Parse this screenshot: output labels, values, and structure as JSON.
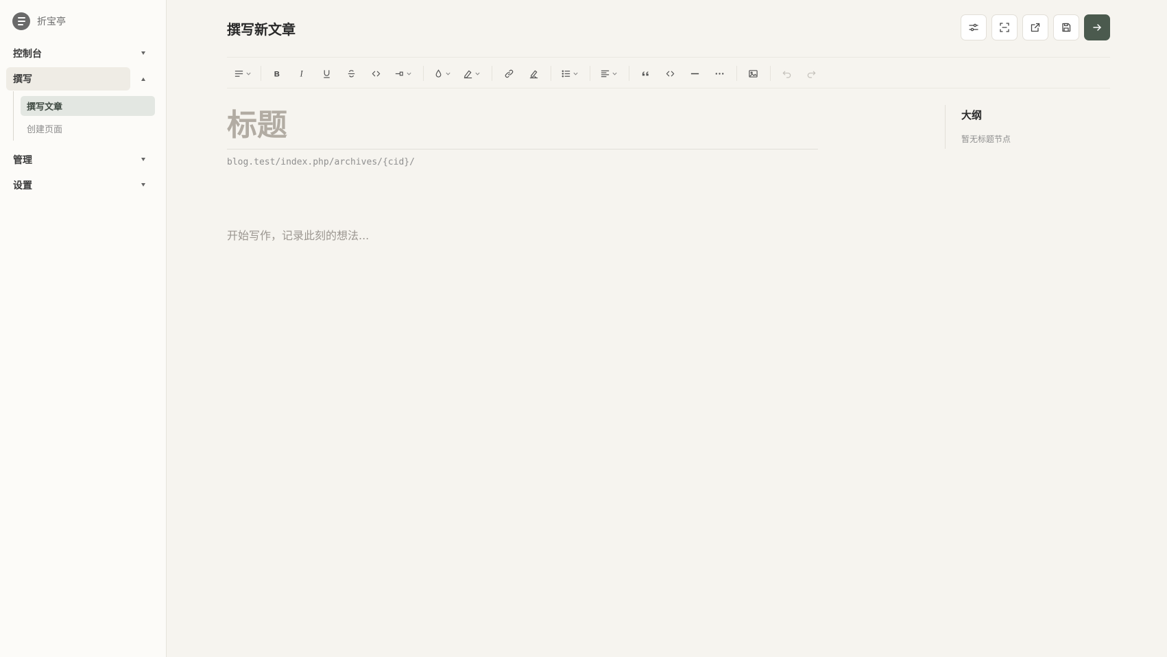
{
  "sidebar": {
    "brand": {
      "name": "折宝亭",
      "icon": "menu-icon"
    },
    "items": [
      {
        "label": "控制台",
        "icon": "caret-down-icon"
      },
      {
        "label": "撰写",
        "icon": "caret-up-icon",
        "expanded": true,
        "children": [
          {
            "label": "撰写文章",
            "active": true
          },
          {
            "label": "创建页面"
          }
        ]
      },
      {
        "label": "管理",
        "icon": "caret-down-icon"
      },
      {
        "label": "设置",
        "icon": "caret-down-icon"
      }
    ]
  },
  "header": {
    "title": "撰写新文章",
    "actions": [
      {
        "icon": "settings-sliders-icon"
      },
      {
        "icon": "focus-mode-icon"
      },
      {
        "icon": "external-preview-icon"
      },
      {
        "icon": "save-draft-icon"
      },
      {
        "icon": "publish-arrow-icon",
        "primary": true
      }
    ]
  },
  "toolbar": {
    "buttons": [
      "paragraph-style-icon",
      "bold-icon",
      "italic-icon",
      "underline-icon",
      "strikethrough-icon",
      "inline-code-icon",
      "highlight-dropdown-icon",
      "font-color-icon",
      "background-color-icon",
      "link-icon",
      "clear-format-icon",
      "list-icon",
      "align-icon",
      "blockquote-icon",
      "code-block-icon",
      "horizontal-rule-icon",
      "more-icon",
      "image-icon",
      "undo-icon",
      "redo-icon"
    ]
  },
  "editor": {
    "title_placeholder": "标题",
    "slug": "blog.test/index.php/archives/{cid}/",
    "body_placeholder": "开始写作，记录此刻的想法..."
  },
  "outline": {
    "title": "大纲",
    "empty": "暂无标题节点"
  },
  "colors": {
    "accent": "#4b5a4e",
    "background": "#f6f4ef",
    "sidebar": "#fcfbf8"
  }
}
